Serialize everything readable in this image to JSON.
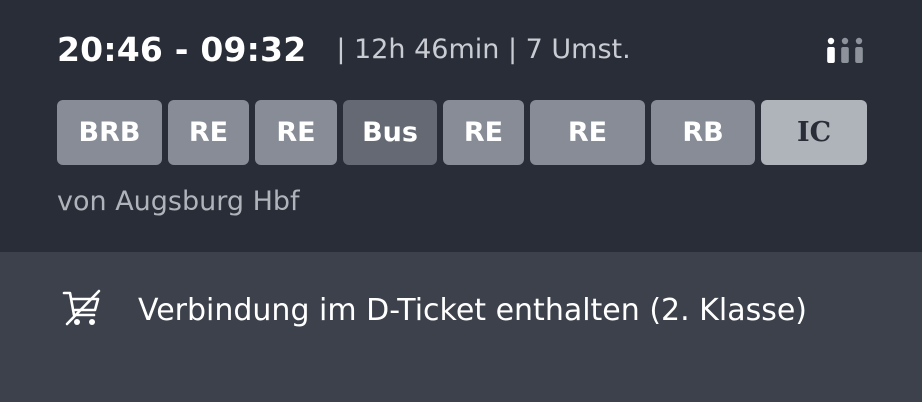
{
  "connection": {
    "times": "20:46 - 09:32",
    "meta": "| 12h 46min | 7 Umst.",
    "from": "von Augsburg Hbf"
  },
  "products": [
    "BRB",
    "RE",
    "RE",
    "Bus",
    "RE",
    "RE",
    "RB",
    "IC"
  ],
  "ticket": {
    "icon": "cart-crossed-icon",
    "text": "Verbindung im D-Ticket enthalten (2. Klasse)"
  },
  "icons": {
    "occupancy": "occupancy-icon"
  },
  "colors": {
    "background_top": "#282d37",
    "background_bottom": "#3c414b",
    "chip_default": "#878c96",
    "chip_bus": "#646973",
    "chip_ic": "#afb4bb"
  }
}
